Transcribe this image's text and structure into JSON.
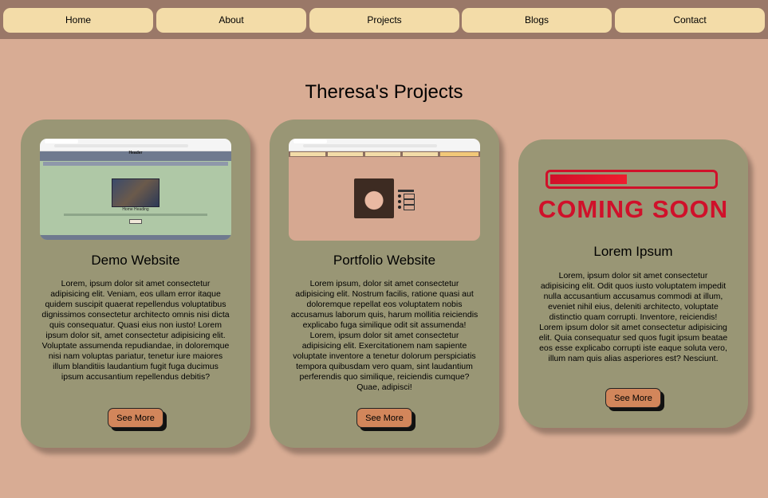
{
  "nav": {
    "items": [
      "Home",
      "About",
      "Projects",
      "Blogs",
      "Contact"
    ]
  },
  "page": {
    "title": "Theresa's Projects"
  },
  "cards": [
    {
      "title": "Demo Website",
      "text": "Lorem, ipsum dolor sit amet consectetur adipisicing elit. Veniam, eos ullam error itaque quidem suscipit quaerat repellendus voluptatibus dignissimos consectetur architecto omnis nisi dicta quis consequatur. Quasi eius non iusto! Lorem ipsum dolor sit, amet consectetur adipisicing elit. Voluptate assumenda repudiandae, in doloremque nisi nam voluptas pariatur, tenetur iure maiores illum blanditiis laudantium fugit fuga ducimus ipsum accusantium repellendus debitis?",
      "button": "See More",
      "thumbnail": {
        "header": "Header",
        "heading": "Home Heading"
      }
    },
    {
      "title": "Portfolio Website",
      "text": "Lorem ipsum, dolor sit amet consectetur adipisicing elit. Nostrum facilis, ratione quasi aut doloremque repellat eos voluptatem nobis accusamus laborum quis, harum mollitia reiciendis explicabo fuga similique odit sit assumenda! Lorem, ipsum dolor sit amet consectetur adipisicing elit. Exercitationem nam sapiente voluptate inventore a tenetur dolorum perspiciatis tempora quibusdam vero quam, sint laudantium perferendis quo similique, reiciendis cumque? Quae, adipisci!",
      "button": "See More"
    },
    {
      "title": "Lorem Ipsum",
      "text": "Lorem, ipsum dolor sit amet consectetur adipisicing elit. Odit quos iusto voluptatem impedit nulla accusantium accusamus commodi at illum, eveniet nihil eius, deleniti architecto, voluptate distinctio quam corrupti. Inventore, reiciendis! Lorem ipsum dolor sit amet consectetur adipisicing elit. Quia consequatur sed quos fugit ipsum beatae eos esse explicabo corrupti iste eaque soluta vero, illum nam quis alias asperiores est? Nesciunt.",
      "button": "See More",
      "coming_soon": "COMING SOON"
    }
  ],
  "colors": {
    "background": "#d8ac94",
    "navbar": "#9a7868",
    "nav_button": "#f3dca8",
    "card": "#999675",
    "button": "#d2865b",
    "coming_soon": "#d0102a"
  }
}
